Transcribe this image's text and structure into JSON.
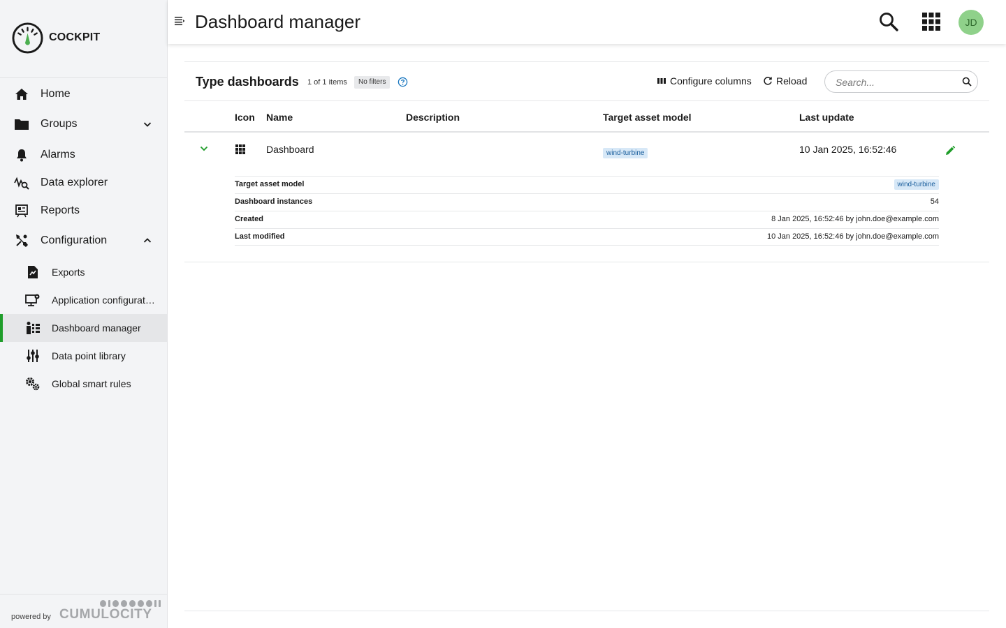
{
  "brand": {
    "name": "COCKPIT"
  },
  "sidebar": {
    "items": [
      {
        "label": "Home",
        "icon": "home-icon"
      },
      {
        "label": "Groups",
        "icon": "folder-icon"
      },
      {
        "label": "Alarms",
        "icon": "bell-icon"
      },
      {
        "label": "Data explorer",
        "icon": "data-explorer-icon"
      },
      {
        "label": "Reports",
        "icon": "report-icon"
      },
      {
        "label": "Configuration",
        "icon": "wrench-icon"
      }
    ],
    "sub_items": [
      {
        "label": "Exports",
        "icon": "export-file-icon"
      },
      {
        "label": "Application configuration",
        "icon": "monitor-settings-icon"
      },
      {
        "label": "Dashboard manager",
        "icon": "dashboard-manager-icon"
      },
      {
        "label": "Data point library",
        "icon": "sliders-icon"
      },
      {
        "label": "Global smart rules",
        "icon": "gears-icon"
      }
    ],
    "footer": {
      "powered": "powered by",
      "vendor": "CUMULOCITY"
    }
  },
  "header": {
    "title": "Dashboard manager",
    "avatar_initials": "JD"
  },
  "card": {
    "title": "Type dashboards",
    "count": "1 of 1 items",
    "filter": "No filters",
    "configure_columns": "Configure columns",
    "reload": "Reload",
    "search_placeholder": "Search..."
  },
  "table": {
    "columns": [
      "Icon",
      "Name",
      "Description",
      "Target asset model",
      "Last update"
    ],
    "rows": [
      {
        "name": "Dashboard",
        "description": "",
        "target": "wind-turbine",
        "last_update": "10 Jan 2025, 16:52:46"
      }
    ]
  },
  "details": [
    {
      "label": "Target asset model",
      "value": "wind-turbine"
    },
    {
      "label": "Dashboard instances",
      "value": "54"
    },
    {
      "label": "Created",
      "value": "8 Jan 2025, 16:52:46 by john.doe@example.com"
    },
    {
      "label": "Last modified",
      "value": "10 Jan 2025, 16:52:46 by john.doe@example.com"
    }
  ],
  "colors": {
    "accent": "#1f9d2a",
    "tag_bg": "#d7e8f7",
    "avatar_bg": "#8fd18a"
  }
}
